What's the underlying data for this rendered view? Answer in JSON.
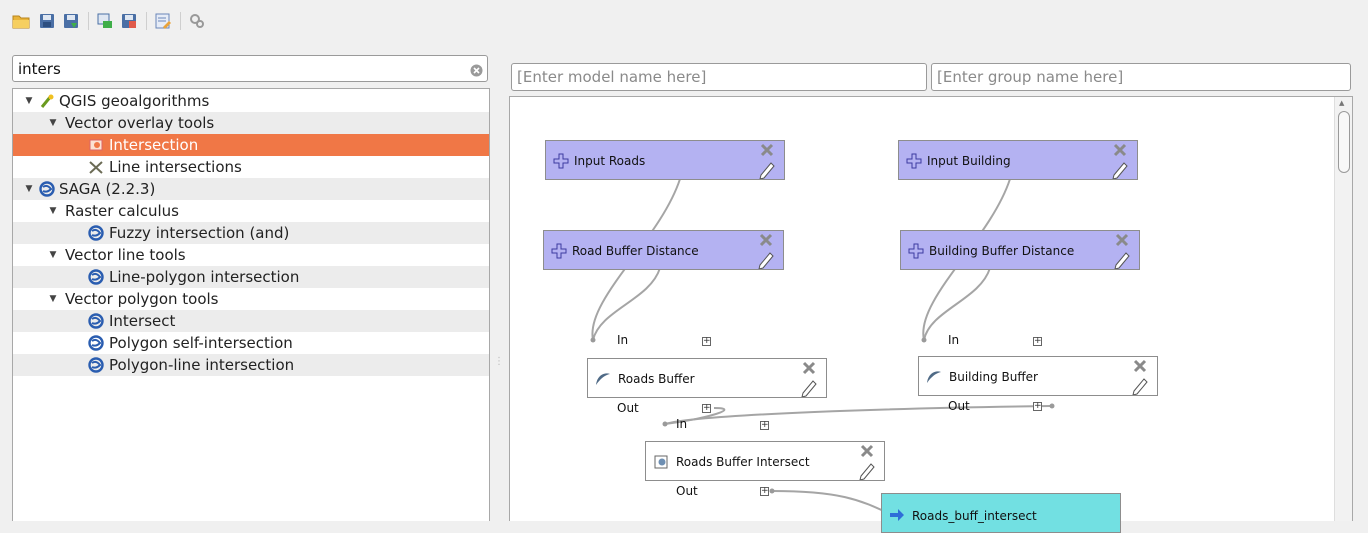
{
  "toolbar": {
    "buttons": [
      {
        "icon": "folder-open-icon",
        "tooltip": "Open model"
      },
      {
        "icon": "save-icon",
        "tooltip": "Save"
      },
      {
        "icon": "save-as-icon",
        "tooltip": "Save as"
      },
      {
        "icon": "export-image-icon",
        "tooltip": "Export as image"
      },
      {
        "icon": "export-python-icon",
        "tooltip": "Export as Python script"
      },
      {
        "icon": "edit-help-icon",
        "tooltip": "Edit model help"
      },
      {
        "icon": "run-model-icon",
        "tooltip": "Run model"
      }
    ]
  },
  "search": {
    "value": "inters"
  },
  "tree": {
    "rows": [
      {
        "label": "QGIS geoalgorithms",
        "level": 0,
        "expanded": true,
        "icon": "qgis-icon"
      },
      {
        "label": "Vector overlay tools",
        "level": 1,
        "expanded": true,
        "icon": ""
      },
      {
        "label": "Intersection",
        "level": 2,
        "selected": true,
        "icon": "intersection-icon"
      },
      {
        "label": "Line intersections",
        "level": 2,
        "icon": "line-intersections-icon"
      },
      {
        "label": "SAGA (2.2.3)",
        "level": 0,
        "expanded": true,
        "icon": "saga-icon"
      },
      {
        "label": "Raster calculus",
        "level": 1,
        "expanded": true,
        "icon": ""
      },
      {
        "label": "Fuzzy intersection (and)",
        "level": 2,
        "icon": "saga-icon"
      },
      {
        "label": "Vector line tools",
        "level": 1,
        "expanded": true,
        "icon": ""
      },
      {
        "label": "Line-polygon intersection",
        "level": 2,
        "icon": "saga-icon"
      },
      {
        "label": "Vector polygon tools",
        "level": 1,
        "expanded": true,
        "icon": ""
      },
      {
        "label": "Intersect",
        "level": 2,
        "icon": "saga-icon"
      },
      {
        "label": "Polygon self-intersection",
        "level": 2,
        "icon": "saga-icon"
      },
      {
        "label": "Polygon-line intersection",
        "level": 2,
        "icon": "saga-icon"
      }
    ]
  },
  "model": {
    "name_placeholder": "[Enter model name here]",
    "group_placeholder": "[Enter group name here]"
  },
  "canvas": {
    "inputs": [
      {
        "label": "Input Roads"
      },
      {
        "label": "Input Building"
      },
      {
        "label": "Road Buffer Distance"
      },
      {
        "label": "Building Buffer Distance"
      }
    ],
    "algorithms": [
      {
        "label": "Roads Buffer",
        "in_label": "In",
        "out_label": "Out"
      },
      {
        "label": "Building Buffer",
        "in_label": "In",
        "out_label": "Out"
      },
      {
        "label": "Roads Buffer Intersect",
        "in_label": "In",
        "out_label": "Out"
      }
    ],
    "outputs": [
      {
        "label": "Roads_buff_intersect"
      }
    ]
  },
  "colors": {
    "selection": "#f07746",
    "input_node": "#b4b2f2",
    "output_node": "#72e0e2",
    "saga_blue": "#2a5db0"
  }
}
